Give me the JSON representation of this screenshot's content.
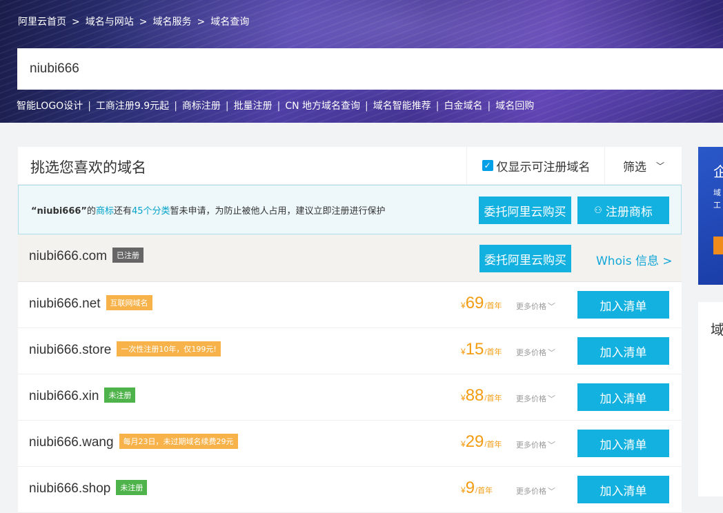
{
  "breadcrumb": [
    "阿里云首页",
    "域名与网站",
    "域名服务",
    "域名查询"
  ],
  "breadcrumb_sep": ">",
  "search": {
    "value": "niubi666"
  },
  "quicklinks": [
    "智能LOGO设计",
    "工商注册9.9元起",
    "商标注册",
    "批量注册",
    "CN 地方域名查询",
    "域名智能推荐",
    "白金域名",
    "域名回购"
  ],
  "quicklinks_sep": "|",
  "panel": {
    "title": "挑选您喜欢的域名",
    "only_available_label": "仅显示可注册域名",
    "only_available_checked": true,
    "filter_label": "筛选"
  },
  "trademark_notice": {
    "name": "“niubi666”",
    "t1": "的",
    "link1": "商标",
    "t2": "还有",
    "link2": "45个分类",
    "t3": "暂未申请，为防止被他人占用，建议立即注册进行保护",
    "btn_entrust": "委托阿里云购买",
    "btn_register": "注册商标"
  },
  "registered_row": {
    "domain": "niubi666.com",
    "tag": "已注册",
    "btn_entrust": "委托阿里云购买",
    "whois": "Whois 信息 >"
  },
  "rows": [
    {
      "domain": "niubi666.net",
      "tag": "互联网域名",
      "tag_color": "#f7b24a",
      "yen": "¥",
      "price": "69",
      "unit": "/首年",
      "more": "更多价格",
      "btn": "加入清单"
    },
    {
      "domain": "niubi666.store",
      "tag": "一次性注册10年，仅199元!",
      "tag_color": "#f7b24a",
      "yen": "¥",
      "price": "15",
      "unit": "/首年",
      "more": "更多价格",
      "btn": "加入清单"
    },
    {
      "domain": "niubi666.xin",
      "tag": "未注册",
      "tag_color": "#4fb34b",
      "yen": "¥",
      "price": "88",
      "unit": "/首年",
      "more": "更多价格",
      "btn": "加入清单"
    },
    {
      "domain": "niubi666.wang",
      "tag": "每月23日，未过期域名续费29元",
      "tag_color": "#f7b24a",
      "yen": "¥",
      "price": "29",
      "unit": "/首年",
      "more": "更多价格",
      "btn": "加入清单"
    },
    {
      "domain": "niubi666.shop",
      "tag": "未注册",
      "tag_color": "#4fb34b",
      "yen": "¥",
      "price": "9",
      "unit": "/首年",
      "more": "更多价格",
      "btn": "加入清单"
    }
  ],
  "side": {
    "card1_title": "企",
    "card1_lines": [
      "域",
      "工"
    ],
    "card2_title": "域"
  },
  "colors": {
    "accent": "#12b1e0",
    "price": "#f39c12",
    "link": "#00a2ca"
  }
}
